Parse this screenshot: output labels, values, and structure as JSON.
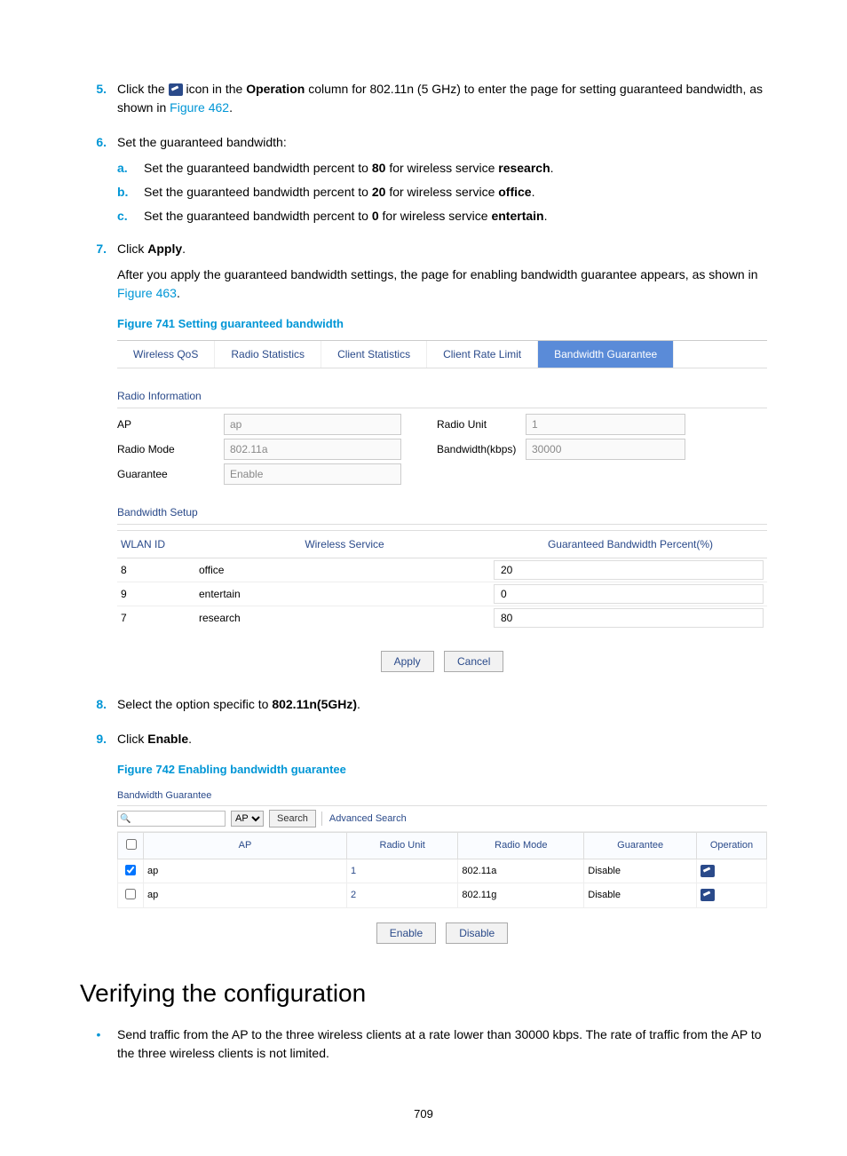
{
  "page_number": "709",
  "steps": [
    {
      "num": "5.",
      "parts": [
        {
          "t": "text",
          "v": "Click the "
        },
        {
          "t": "icon",
          "v": "edit-icon"
        },
        {
          "t": "text",
          "v": " icon in the "
        },
        {
          "t": "bold",
          "v": "Operation"
        },
        {
          "t": "text",
          "v": " column for 802.11n (5 GHz) to enter the page for setting guaranteed bandwidth, as shown in "
        },
        {
          "t": "link",
          "v": "Figure 462"
        },
        {
          "t": "text",
          "v": "."
        }
      ]
    }
  ],
  "step6": {
    "num": "6.",
    "lead": "Set the guaranteed bandwidth:",
    "subs": [
      {
        "m": "a.",
        "pre": "Set the guaranteed bandwidth percent to ",
        "val": "80",
        "mid": " for wireless service ",
        "svc": "research",
        "suf": "."
      },
      {
        "m": "b.",
        "pre": "Set the guaranteed bandwidth percent to ",
        "val": "20",
        "mid": " for wireless service ",
        "svc": "office",
        "suf": "."
      },
      {
        "m": "c.",
        "pre": "Set the guaranteed bandwidth percent to ",
        "val": "0",
        "mid": " for wireless service ",
        "svc": "entertain",
        "suf": "."
      }
    ]
  },
  "step7": {
    "num": "7.",
    "line1_pre": "Click ",
    "line1_b": "Apply",
    "line1_suf": ".",
    "para2_pre": "After you apply the guaranteed bandwidth settings, the page for enabling bandwidth guarantee appears, as shown in ",
    "para2_link": "Figure 463",
    "para2_suf": "."
  },
  "fig741": {
    "caption": "Figure 741 Setting guaranteed bandwidth",
    "tabs": [
      "Wireless QoS",
      "Radio Statistics",
      "Client Statistics",
      "Client Rate Limit",
      "Bandwidth Guarantee"
    ],
    "radio_info_title": "Radio Information",
    "fields": {
      "ap_label": "AP",
      "ap_val": "ap",
      "ru_label": "Radio Unit",
      "ru_val": "1",
      "rm_label": "Radio Mode",
      "rm_val": "802.11a",
      "bw_label": "Bandwidth(kbps)",
      "bw_val": "30000",
      "g_label": "Guarantee",
      "g_val": "Enable"
    },
    "bw_setup_title": "Bandwidth Setup",
    "cols": [
      "WLAN ID",
      "Wireless Service",
      "Guaranteed Bandwidth Percent(%)"
    ],
    "rows": [
      {
        "id": "8",
        "svc": "office",
        "pct": "20"
      },
      {
        "id": "9",
        "svc": "entertain",
        "pct": "0"
      },
      {
        "id": "7",
        "svc": "research",
        "pct": "80"
      }
    ],
    "buttons": {
      "apply": "Apply",
      "cancel": "Cancel"
    }
  },
  "step8": {
    "num": "8.",
    "pre": "Select the option specific to ",
    "b": "802.11n(5GHz)",
    "suf": "."
  },
  "step9": {
    "num": "9.",
    "pre": "Click ",
    "b": "Enable",
    "suf": "."
  },
  "fig742": {
    "caption": "Figure 742 Enabling bandwidth guarantee",
    "title": "Bandwidth Guarantee",
    "search": {
      "dropdown": "AP",
      "button": "Search",
      "adv": "Advanced Search"
    },
    "cols": [
      "AP",
      "Radio Unit",
      "Radio Mode",
      "Guarantee",
      "Operation"
    ],
    "rows": [
      {
        "chk": true,
        "ap": "ap",
        "ru": "1",
        "rm": "802.11a",
        "g": "Disable"
      },
      {
        "chk": false,
        "ap": "ap",
        "ru": "2",
        "rm": "802.11g",
        "g": "Disable"
      }
    ],
    "buttons": {
      "enable": "Enable",
      "disable": "Disable"
    }
  },
  "section_title": "Verifying the configuration",
  "verify_bullet": "Send traffic from the AP to the three wireless clients at a rate lower than 30000 kbps. The rate of traffic from the AP to the three wireless clients is not limited."
}
